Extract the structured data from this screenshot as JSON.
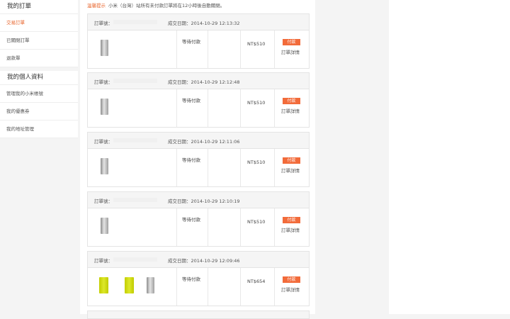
{
  "sidebar": {
    "groups": [
      {
        "title": "我的訂單",
        "items": [
          "交易訂單",
          "已關閉訂單",
          "退款單"
        ]
      },
      {
        "title": "我的個人資料",
        "items": [
          "管理我的小米帳號",
          "我的優惠券",
          "我的地址管理"
        ]
      }
    ]
  },
  "notice": {
    "tag": "溫馨提示",
    "text": "小米（台灣）站所有未付款訂單將在12小時後自動關閉。"
  },
  "orders": [
    {
      "no_label": "訂單號：",
      "date_label": "成交日期：2014-10-29 12:13:32",
      "status": "等待付款",
      "price": "NT$510",
      "pay": "付款",
      "detail": "訂單詳情"
    },
    {
      "no_label": "訂單號：",
      "date_label": "成交日期：2014-10-29 12:12:48",
      "status": "等待付款",
      "price": "NT$510",
      "pay": "付款",
      "detail": "訂單詳情"
    },
    {
      "no_label": "訂單號：",
      "date_label": "成交日期：2014-10-29 12:11:06",
      "status": "等待付款",
      "price": "NT$510",
      "pay": "付款",
      "detail": "訂單詳情"
    },
    {
      "no_label": "訂單號：",
      "date_label": "成交日期：2014-10-29 12:10:19",
      "status": "等待付款",
      "price": "NT$510",
      "pay": "付款",
      "detail": "訂單詳情"
    },
    {
      "no_label": "訂單號：",
      "date_label": "成交日期：2014-10-29 12:09:46",
      "status": "等待付款",
      "price": "NT$654",
      "pay": "付款",
      "detail": "訂單詳情"
    }
  ],
  "colors": {
    "accent": "#e8642b",
    "pay_button": "#f26b3a"
  },
  "icons": {
    "silver_product": "power-bank-silver-icon",
    "yellow_product": "power-bank-yellow-icon"
  }
}
